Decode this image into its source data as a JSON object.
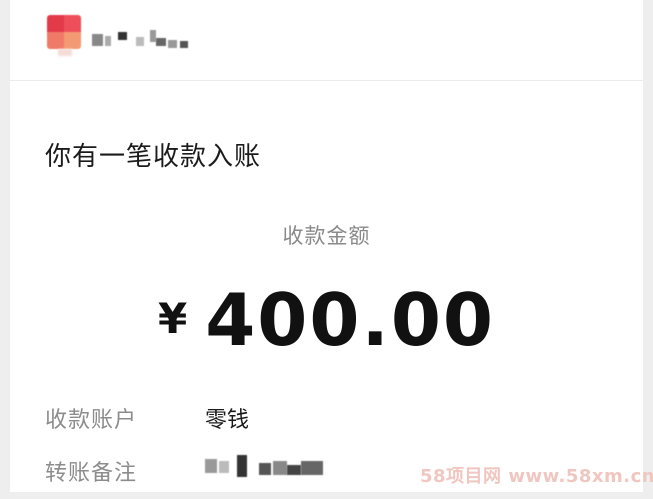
{
  "notification": {
    "title": "你有一笔收款入账",
    "amount_label": "收款金额",
    "currency_symbol": "¥",
    "amount": "400.00"
  },
  "details": [
    {
      "label": "收款账户",
      "value": "零钱"
    },
    {
      "label": "转账备注",
      "value": ""
    }
  ],
  "watermark": "58项目网 www.58xm.cn"
}
